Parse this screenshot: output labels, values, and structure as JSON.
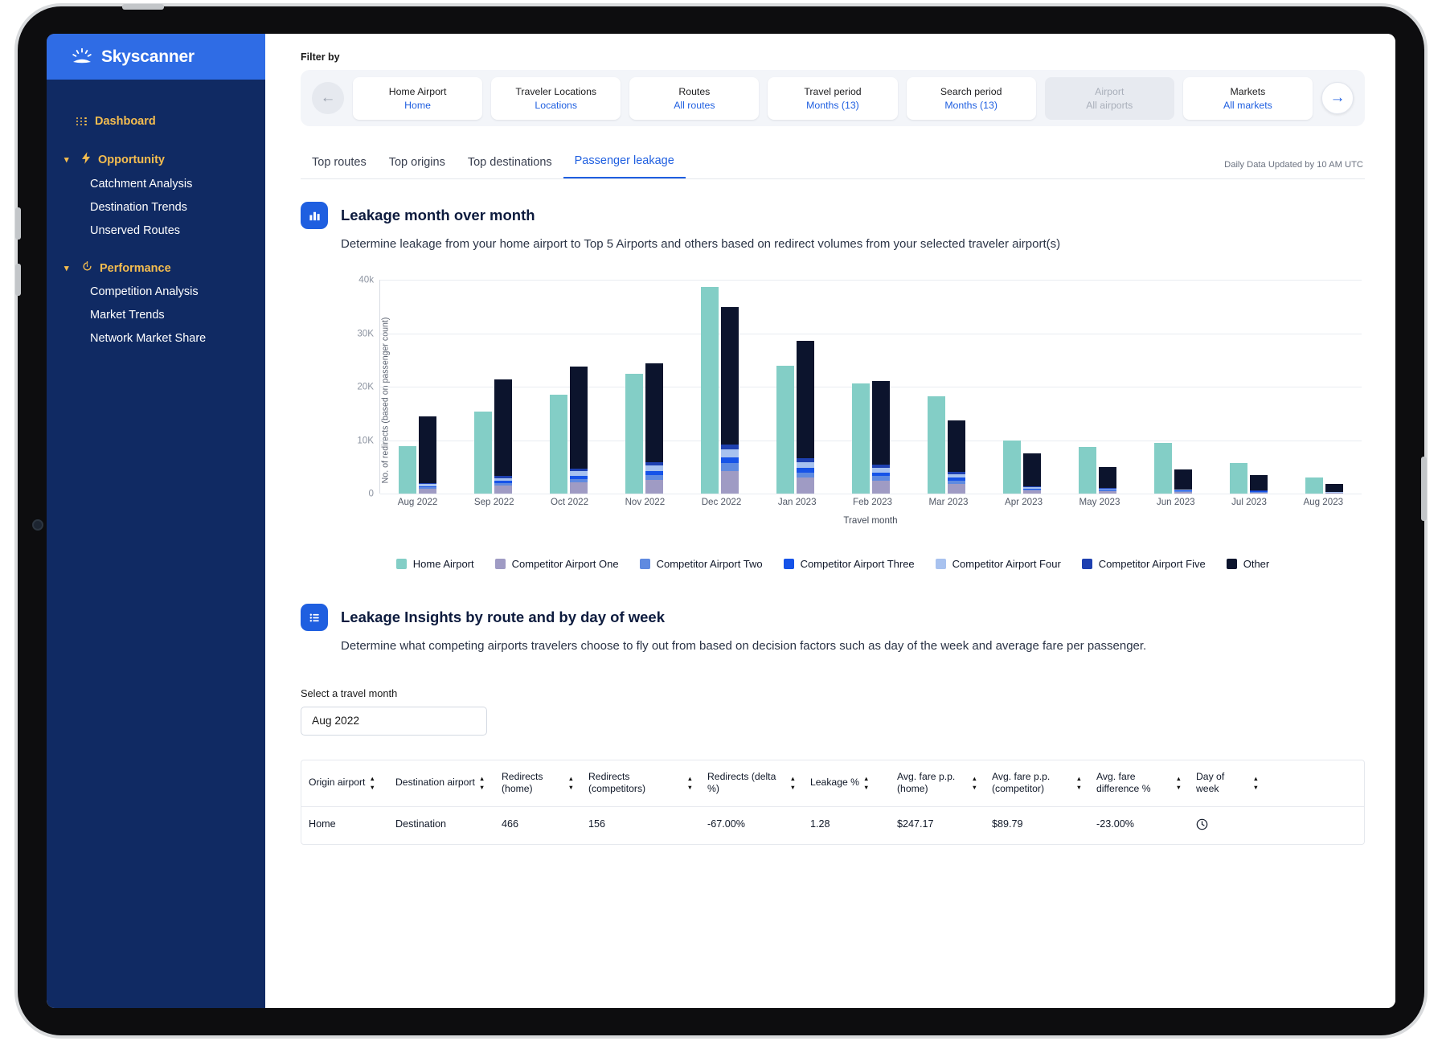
{
  "brand": {
    "name": "Skyscanner",
    "accent": "#2f6ce5",
    "sidebar_bg": "#102a63",
    "gold": "#f5bd4f"
  },
  "sidebar": {
    "dashboard": "Dashboard",
    "groups": [
      {
        "label": "Opportunity",
        "icon": "bolt-icon",
        "items": [
          "Catchment Analysis",
          "Destination Trends",
          "Unserved Routes"
        ]
      },
      {
        "label": "Performance",
        "icon": "timer-icon",
        "items": [
          "Competition Analysis",
          "Market Trends",
          "Network Market Share"
        ]
      }
    ]
  },
  "filter": {
    "label": "Filter by",
    "chips": [
      {
        "title": "Home Airport",
        "value": "Home",
        "disabled": false
      },
      {
        "title": "Traveler Locations",
        "value": "Locations",
        "disabled": false
      },
      {
        "title": "Routes",
        "value": "All routes",
        "disabled": false
      },
      {
        "title": "Travel period",
        "value": "Months (13)",
        "disabled": false
      },
      {
        "title": "Search period",
        "value": "Months (13)",
        "disabled": false
      },
      {
        "title": "Airport",
        "value": "All airports",
        "disabled": true
      },
      {
        "title": "Markets",
        "value": "All markets",
        "disabled": false
      }
    ],
    "back_icon": "arrow-left-icon",
    "next_icon": "arrow-right-icon"
  },
  "tabs": {
    "items": [
      "Top routes",
      "Top origins",
      "Top destinations",
      "Passenger leakage"
    ],
    "active_index": 3,
    "updated_note": "Daily Data Updated by 10 AM UTC"
  },
  "section_leakage": {
    "icon": "bar-chart-icon",
    "title": "Leakage month over month",
    "description": "Determine leakage from your home airport to Top 5 Airports and others based on redirect volumes from your selected traveler airport(s)"
  },
  "section_insights": {
    "icon": "list-icon",
    "title": "Leakage Insights by route and by day of week",
    "description": "Determine what competing airports travelers choose to fly out from based on decision factors such as day of the week and average fare per passenger."
  },
  "month_picker": {
    "label": "Select a travel month",
    "value": "Aug 2022"
  },
  "chart_data": {
    "type": "bar",
    "title": "Leakage month over month",
    "xlabel": "Travel month",
    "ylabel": "No. of redirects (based on passenger count)",
    "ylim": [
      0,
      40000
    ],
    "yticks": [
      0,
      10000,
      20000,
      30000,
      40000
    ],
    "ytick_labels": [
      "0",
      "10K",
      "20K",
      "30K",
      "40k"
    ],
    "grid": true,
    "legend_position": "bottom",
    "grouping": "grouped-with-stacked-competitors",
    "categories": [
      "Aug 2022",
      "Sep 2022",
      "Oct 2022",
      "Nov 2022",
      "Dec 2022",
      "Jan 2023",
      "Feb 2023",
      "Mar 2023",
      "Apr 2023",
      "May 2023",
      "Jun 2023",
      "Jul 2023",
      "Aug 2023"
    ],
    "colors": {
      "Home Airport": "#83cec6",
      "Competitor Airport One": "#9f9bc4",
      "Competitor Airport Two": "#5f8ae0",
      "Competitor Airport Three": "#1653e8",
      "Competitor Airport Four": "#a8c2ef",
      "Competitor Airport Five": "#1e40b0",
      "Other": "#0c142d"
    },
    "series": [
      {
        "name": "Home Airport",
        "bar": "home",
        "values": [
          8900,
          15400,
          18600,
          22400,
          38700,
          24000,
          20600,
          18300,
          9900,
          8800,
          9500,
          5700,
          3100
        ]
      },
      {
        "name": "Competitor Airport One",
        "bar": "competitors",
        "values": [
          900,
          1500,
          2100,
          2600,
          4300,
          3000,
          2500,
          1900,
          600,
          450,
          350,
          250,
          150
        ]
      },
      {
        "name": "Competitor Airport Two",
        "bar": "competitors",
        "values": [
          300,
          500,
          700,
          900,
          1400,
          1000,
          800,
          600,
          220,
          180,
          140,
          110,
          70
        ]
      },
      {
        "name": "Competitor Airport Three",
        "bar": "competitors",
        "values": [
          250,
          400,
          600,
          750,
          1100,
          850,
          700,
          500,
          180,
          150,
          120,
          90,
          55
        ]
      },
      {
        "name": "Competitor Airport Four",
        "bar": "competitors",
        "values": [
          350,
          550,
          800,
          1000,
          1500,
          1100,
          900,
          650,
          240,
          200,
          160,
          120,
          75
        ]
      },
      {
        "name": "Competitor Airport Five",
        "bar": "competitors",
        "values": [
          200,
          350,
          500,
          650,
          900,
          700,
          550,
          400,
          150,
          120,
          100,
          70,
          45
        ]
      },
      {
        "name": "Other",
        "bar": "competitors",
        "values": [
          12500,
          18050,
          19150,
          18500,
          25800,
          22000,
          15700,
          9700,
          6200,
          3900,
          3650,
          2800,
          1400
        ]
      }
    ],
    "totals_competitors": [
      14500,
      21350,
      23850,
      24400,
      35000,
      28650,
      21150,
      13750,
      7590,
      5000,
      4520,
      3440,
      1795
    ]
  },
  "table": {
    "columns": [
      "Origin airport",
      "Destination airport",
      "Redirects (home)",
      "Redirects (competitors)",
      "Redirects (delta %)",
      "Leakage %",
      "Avg. fare p.p. (home)",
      "Avg. fare p.p. (competitor)",
      "Avg. fare difference %",
      "Day of week"
    ],
    "rows": [
      {
        "origin_airport": "Home",
        "destination_airport": "Destination",
        "redirects_home": "466",
        "redirects_competitors": "156",
        "redirects_delta": "-67.00%",
        "leakage_pct": "1.28",
        "avg_fare_home": "$247.17",
        "avg_fare_competitor": "$89.79",
        "avg_fare_difference": "-23.00%",
        "day_of_week": "clock-icon"
      }
    ]
  }
}
